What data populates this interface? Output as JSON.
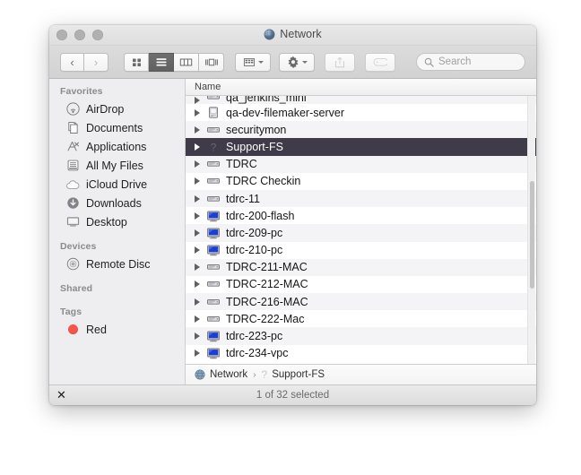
{
  "window": {
    "title": "Network",
    "title_icon": "globe-icon",
    "traffic_lights": [
      "close",
      "minimize",
      "zoom"
    ]
  },
  "toolbar": {
    "back_label": "‹",
    "forward_label": "›",
    "view_buttons": [
      {
        "name": "icon-view",
        "label": "icon-grid-icon",
        "active": false
      },
      {
        "name": "list-view",
        "label": "list-lines-icon",
        "active": true
      },
      {
        "name": "column-view",
        "label": "columns-icon",
        "active": false
      },
      {
        "name": "coverflow-view",
        "label": "coverflow-icon",
        "active": false
      }
    ],
    "arrange_label": "arrange-grid-icon",
    "action_label": "gear-icon",
    "share_label": "share-icon",
    "tag_label": "tag-icon"
  },
  "search": {
    "placeholder": "Search",
    "value": "",
    "icon": "search-icon"
  },
  "sidebar": {
    "sections": [
      {
        "header": "Favorites",
        "items": [
          {
            "label": "AirDrop",
            "icon": "airdrop-icon"
          },
          {
            "label": "Documents",
            "icon": "documents-icon"
          },
          {
            "label": "Applications",
            "icon": "applications-icon"
          },
          {
            "label": "All My Files",
            "icon": "all-my-files-icon"
          },
          {
            "label": "iCloud Drive",
            "icon": "icloud-icon"
          },
          {
            "label": "Downloads",
            "icon": "downloads-icon"
          },
          {
            "label": "Desktop",
            "icon": "desktop-icon"
          }
        ]
      },
      {
        "header": "Devices",
        "items": [
          {
            "label": "Remote Disc",
            "icon": "disc-icon"
          }
        ]
      },
      {
        "header": "Shared",
        "items": []
      },
      {
        "header": "Tags",
        "items": [
          {
            "label": "Red",
            "icon": "tag-dot-red",
            "color": "#f8544f"
          }
        ]
      }
    ]
  },
  "file_list": {
    "column_header": "Name",
    "rows": [
      {
        "label": "qa_jenkins_mini",
        "icon": "server-icon",
        "selected": false,
        "clipped": true
      },
      {
        "label": "qa-dev-filemaker-server",
        "icon": "tower-icon",
        "selected": false
      },
      {
        "label": "securitymon",
        "icon": "server-icon",
        "selected": false
      },
      {
        "label": "Support-FS",
        "icon": "unknown-icon",
        "selected": true
      },
      {
        "label": "TDRC",
        "icon": "server-icon",
        "selected": false
      },
      {
        "label": "TDRC Checkin",
        "icon": "server-icon",
        "selected": false
      },
      {
        "label": "tdrc-11",
        "icon": "server-icon",
        "selected": false
      },
      {
        "label": "tdrc-200-flash",
        "icon": "pc-monitor-icon",
        "selected": false
      },
      {
        "label": "tdrc-209-pc",
        "icon": "pc-monitor-icon",
        "selected": false
      },
      {
        "label": "tdrc-210-pc",
        "icon": "pc-monitor-icon",
        "selected": false
      },
      {
        "label": "TDRC-211-MAC",
        "icon": "server-icon",
        "selected": false
      },
      {
        "label": "TDRC-212-MAC",
        "icon": "server-icon",
        "selected": false
      },
      {
        "label": "TDRC-216-MAC",
        "icon": "server-icon",
        "selected": false
      },
      {
        "label": "TDRC-222-Mac",
        "icon": "server-icon",
        "selected": false
      },
      {
        "label": "tdrc-223-pc",
        "icon": "pc-monitor-icon",
        "selected": false
      },
      {
        "label": "tdrc-234-vpc",
        "icon": "pc-monitor-icon",
        "selected": false
      }
    ]
  },
  "path_bar": {
    "segments": [
      {
        "label": "Network",
        "icon": "globe-icon"
      },
      {
        "label": "Support-FS",
        "icon": "unknown-icon"
      }
    ],
    "separator": "›"
  },
  "status_bar": {
    "text": "1 of 32 selected",
    "left_icon": "close-x-icon",
    "left_icon_glyph": "✕"
  },
  "colors": {
    "selection": "#3f3b48",
    "sidebar_bg": "#eeeef0",
    "alt_row": "#f4f4f6",
    "tag_red": "#f8544f",
    "pc_icon_blue": "#1a3fd6"
  }
}
